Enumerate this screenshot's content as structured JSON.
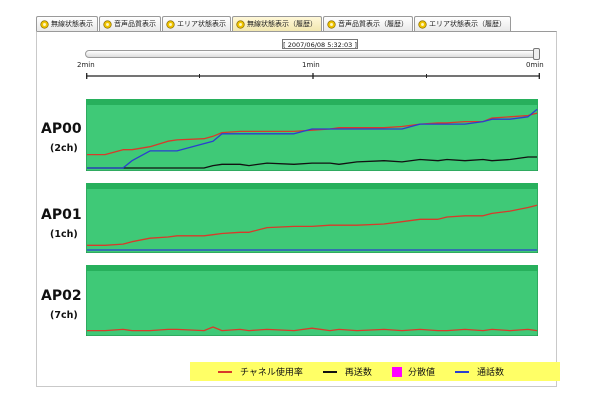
{
  "tabs": [
    {
      "label": "無線状態表示",
      "active": false
    },
    {
      "label": "音声品質表示",
      "active": false
    },
    {
      "label": "エリア状態表示",
      "active": false
    },
    {
      "label": "無線状態表示（履歴）",
      "active": true
    },
    {
      "label": "音声品質表示（履歴）",
      "active": false
    },
    {
      "label": "エリア状態表示（履歴）",
      "active": false
    }
  ],
  "timestamp": "[ 2007/06/08 5:32:03 ]",
  "slider_position": 1.0,
  "time_axis": {
    "left": "2min",
    "center": "1min",
    "right": "0min"
  },
  "access_points": [
    {
      "name": "AP00",
      "channel": "(2ch)"
    },
    {
      "name": "AP01",
      "channel": "(1ch)"
    },
    {
      "name": "AP02",
      "channel": "(7ch)"
    }
  ],
  "legend": [
    {
      "label": "チャネル使用率",
      "color": "#d83a2a",
      "kind": "line"
    },
    {
      "label": "再送数",
      "color": "#111111",
      "kind": "line"
    },
    {
      "label": "分散値",
      "color": "#ff00ff",
      "kind": "box"
    },
    {
      "label": "通話数",
      "color": "#2a3fd0",
      "kind": "line"
    }
  ],
  "colors": {
    "plot_bg": "#3fc977",
    "plot_band": "#27b05c"
  },
  "chart_data": [
    {
      "type": "line",
      "x": [
        0,
        4,
        8,
        10,
        14,
        18,
        20,
        26,
        28,
        30,
        34,
        36,
        40,
        46,
        50,
        54,
        56,
        60,
        66,
        70,
        74,
        78,
        80,
        84,
        88,
        90,
        94,
        98,
        100
      ],
      "series": [
        {
          "name": "チャネル使用率",
          "values": [
            22,
            22,
            30,
            30,
            35,
            44,
            46,
            48,
            52,
            58,
            60,
            60,
            60,
            60,
            62,
            64,
            66,
            66,
            66,
            68,
            72,
            74,
            74,
            76,
            76,
            82,
            84,
            86,
            90
          ]
        },
        {
          "name": "再送数",
          "values": [
            0,
            0,
            0,
            0,
            0,
            0,
            0,
            0,
            4,
            6,
            6,
            4,
            8,
            6,
            8,
            8,
            6,
            10,
            12,
            10,
            14,
            12,
            14,
            12,
            14,
            12,
            14,
            18,
            18
          ]
        },
        {
          "name": "通話数",
          "values": [
            0,
            0,
            0,
            12,
            28,
            28,
            28,
            40,
            44,
            56,
            56,
            56,
            56,
            56,
            64,
            64,
            64,
            64,
            64,
            64,
            72,
            72,
            72,
            72,
            76,
            80,
            80,
            84,
            96
          ]
        }
      ]
    },
    {
      "type": "line",
      "x": [
        0,
        4,
        8,
        10,
        14,
        18,
        20,
        26,
        28,
        30,
        34,
        36,
        40,
        46,
        50,
        54,
        56,
        60,
        66,
        70,
        74,
        78,
        80,
        84,
        88,
        90,
        94,
        98,
        100
      ],
      "series": [
        {
          "name": "チャネル使用率",
          "values": [
            8,
            8,
            10,
            14,
            20,
            22,
            24,
            24,
            26,
            28,
            30,
            30,
            38,
            40,
            40,
            42,
            42,
            42,
            44,
            48,
            52,
            52,
            56,
            58,
            58,
            62,
            66,
            72,
            76
          ]
        },
        {
          "name": "通話数",
          "values": [
            0,
            0,
            0,
            0,
            0,
            0,
            0,
            0,
            0,
            0,
            0,
            0,
            0,
            0,
            0,
            0,
            0,
            0,
            0,
            0,
            0,
            0,
            0,
            0,
            0,
            0,
            0,
            0,
            0
          ]
        }
      ]
    },
    {
      "type": "line",
      "x": [
        0,
        4,
        8,
        10,
        14,
        18,
        20,
        26,
        28,
        30,
        34,
        36,
        40,
        46,
        50,
        54,
        56,
        60,
        66,
        70,
        74,
        78,
        80,
        84,
        88,
        90,
        94,
        98,
        100
      ],
      "series": [
        {
          "name": "チャネル使用率",
          "values": [
            4,
            4,
            6,
            4,
            4,
            6,
            6,
            4,
            10,
            4,
            6,
            4,
            6,
            4,
            8,
            4,
            6,
            4,
            6,
            4,
            6,
            4,
            4,
            6,
            4,
            6,
            4,
            6,
            4
          ]
        }
      ]
    }
  ]
}
